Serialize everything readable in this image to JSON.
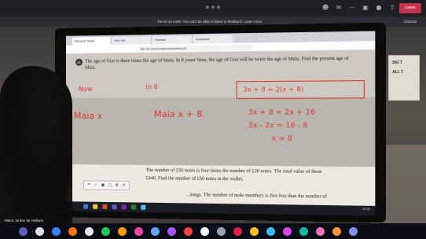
{
  "meeting": {
    "leave_label": "Leave",
    "notice_text": "You're on mute. You can't be able to listen to feedback. Learn more",
    "notice_dismiss": "Dismiss",
    "participant_name": "Maire Jordan de Holbers"
  },
  "browser": {
    "tabs": [
      "Microsoft Teams",
      "New Tab",
      "OneNote",
      "Worksheet"
    ],
    "url": "file:///C:/Users/maths/worksheet.pdf"
  },
  "poster": {
    "line1": "SKI T",
    "line2": "ALL T"
  },
  "worksheet": {
    "q1_number": "25.",
    "q1_text": "The age of Guo is three times the age of Maia. In 8 years' time, the age of Guo will be twice the age of Maia. Find the present age of Maia.",
    "q2_text": "The number of £50 notes is four times the number of £20 notes. The total value of these",
    "q2_text_2": "£440. Find the number of £50 notes in the wallet.",
    "q3_text": "...kings. The number of male members is five less than the number of"
  },
  "annotations": {
    "now": "Now",
    "in8": "in 8",
    "maia_x": "Maia  x",
    "maia_x8": "Maia  x + 8",
    "eq1": "3x + 8 = 2(x + 8)",
    "eq2": "3x + 8 = 2x + 16",
    "eq3": "3x - 2x = 16 - 8",
    "eq4": "x = 8"
  },
  "taskbar": {
    "clock": "10:33"
  },
  "colors": {
    "ink_red": "#e0362a",
    "leave_red": "#c4314b"
  }
}
